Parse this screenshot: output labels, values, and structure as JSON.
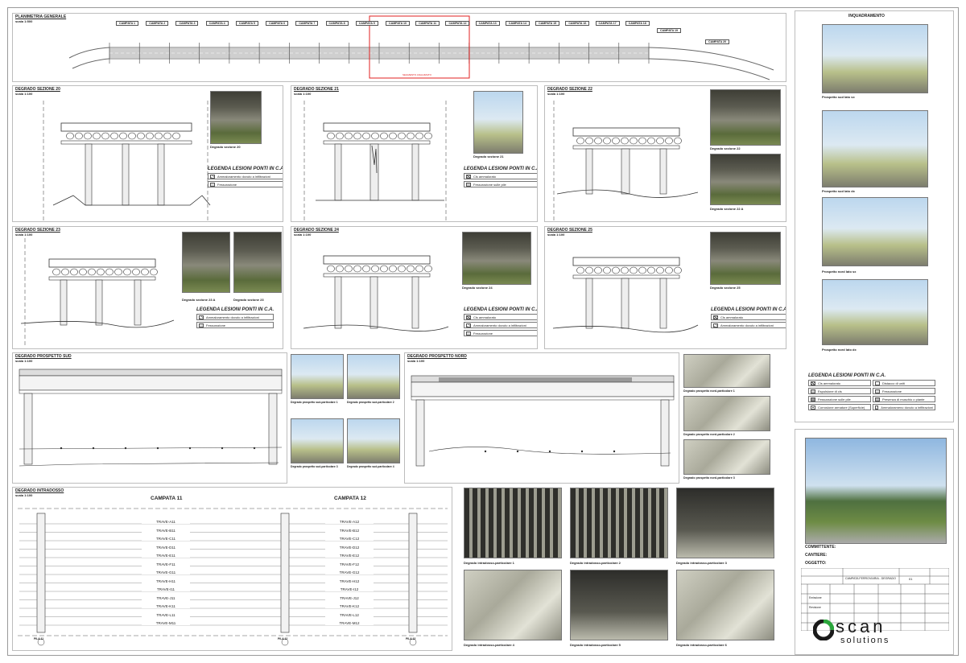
{
  "planimetria": {
    "title": "PLANIMETRIA GENERALE",
    "scale": "scala 1:500",
    "campate": [
      "CAMPATA 1",
      "CAMPATA 2",
      "CAMPATA 3",
      "CAMPATA 4",
      "CAMPATA 5",
      "CAMPATA 6",
      "CAMPATA 7",
      "CAMPATA 8",
      "CAMPATA 9",
      "CAMPATA 10",
      "CAMPATA 11",
      "CAMPATA 12",
      "CAMPATA 13",
      "CAMPATA 14",
      "CAMPATA 15",
      "CAMPATA 16",
      "CAMPATA 17",
      "CAMPATA 18",
      "CAMPATA 19",
      "CAMPATA 20"
    ],
    "highlight_color": "#e02020"
  },
  "sections": [
    {
      "title": "DEGRADO SEZIONE 20",
      "scale": "scala 1:100",
      "photos": [
        "Degrado sezione 20"
      ]
    },
    {
      "title": "DEGRADO SEZIONE 21",
      "scale": "scala 1:100",
      "photos": [
        "Degrado sezione 21"
      ]
    },
    {
      "title": "DEGRADO SEZIONE 22",
      "scale": "scala 1:100",
      "photos": [
        "Degrado sezione 22",
        "Degrado sezione 22 A"
      ]
    },
    {
      "title": "DEGRADO SEZIONE 23",
      "scale": "scala 1:100",
      "photos": [
        "Degrado sezione 23 A",
        "Degrado sezione 23"
      ]
    },
    {
      "title": "DEGRADO SEZIONE 24",
      "scale": "scala 1:100",
      "photos": [
        "Degrado sezione 24"
      ]
    },
    {
      "title": "DEGRADO SEZIONE 25",
      "scale": "scala 1:100",
      "photos": [
        "Degrado sezione 25"
      ]
    }
  ],
  "legends": {
    "title": "LEGENDA LESIONI  PONTI IN C.A.",
    "s20": [
      "Ammaloramento dovuto a infiltrazioni",
      "Fessurazione"
    ],
    "s21": [
      "Cls ammalorato",
      "Fessurazione sulle pile"
    ],
    "s23": [
      "Ammaloramento dovuto a infiltrazioni",
      "Fessurazione"
    ],
    "s24": [
      "Cls ammalorato",
      "Ammaloramento dovuto a infiltrazioni",
      "Fessurazione"
    ],
    "s25": [
      "Cls ammalorato",
      "Ammaloramento dovuto a infiltrazioni"
    ]
  },
  "prospetto_sud": {
    "title": "DEGRADO PROSPETTO SUD",
    "scale": "scala 1:100",
    "photos": [
      "Degrado prospetto sud-particolare 1",
      "Degrado prospetto sud-particolare 2",
      "Degrado prospetto sud-particolare 3",
      "Degrado prospetto sud-particolare 4"
    ]
  },
  "prospetto_nord": {
    "title": "DEGRADO PROSPETTO NORD",
    "scale": "scala 1:100",
    "photos": [
      "Degrado prospetto nord-particolare 1",
      "Degrado prospetto nord-particolare 2",
      "Degrado prospetto nord-particolare 3"
    ]
  },
  "intradosso": {
    "title": "DEGRADO INTRADOSSO",
    "scale": "scala 1:100",
    "campata_a": "CAMPATA 11",
    "campata_b": "CAMPATA 12",
    "travi_a": [
      "TRAVE-A11",
      "TRAVE-B11",
      "TRAVE-C11",
      "TRAVE-D11",
      "TRAVE-E11",
      "TRAVE-F11",
      "TRAVE-G11",
      "TRAVE-H11",
      "TRAVE-I11",
      "TRAVE-J11",
      "TRAVE-K11",
      "TRAVE-L11",
      "TRAVE-M11"
    ],
    "travi_b": [
      "TRAVE-A12",
      "TRAVE-B12",
      "TRAVE-C12",
      "TRAVE-D12",
      "TRAVE-E12",
      "TRAVE-F12",
      "TRAVE-G12",
      "TRAVE-H12",
      "TRAVE-I12",
      "TRAVE-J12",
      "TRAVE-K12",
      "TRAVE-L12",
      "TRAVE-M12"
    ],
    "pile": [
      "PILA 11",
      "PILA 12",
      "PILA 13"
    ],
    "photos": [
      "Degrado intradosso-particolare 1",
      "Degrado intradosso-particolare 2",
      "Degrado intradosso-particolare 3",
      "Degrado intradosso-particolare 4",
      "Degrado intradosso-particolare 5",
      "Degrado intradosso-particolare 6"
    ]
  },
  "inquadramento": {
    "title": "INQUADRAMENTO",
    "photos": [
      "Prospetto sud lato sx",
      "Prospetto sud lato dx",
      "Prospetto nord lato sx",
      "Prospetto nord lato dx"
    ],
    "legend": [
      "Cls ammalorato",
      "Distacco di uniti",
      "Espulsione di cls",
      "Fessurazione",
      "Fessurazione sulle pile",
      "Presenza di muschio o piante",
      "Corrosione armature (Superficie)",
      "Ammalorameno dovuto a infiltrazioni"
    ]
  },
  "titleblock": {
    "committente": "COMMITTENTE:",
    "cantiere": "CANTIERE:",
    "oggetto": "OGGETTO:",
    "subject": "CAMPATA FERROVIARIA - DEGRADO",
    "sheet": "01",
    "rows": [
      "Emissione",
      "Revisione"
    ],
    "logo_main": "scan",
    "logo_sub": "solutions"
  },
  "colors": {
    "accent": "#e02020",
    "line": "#555555"
  }
}
